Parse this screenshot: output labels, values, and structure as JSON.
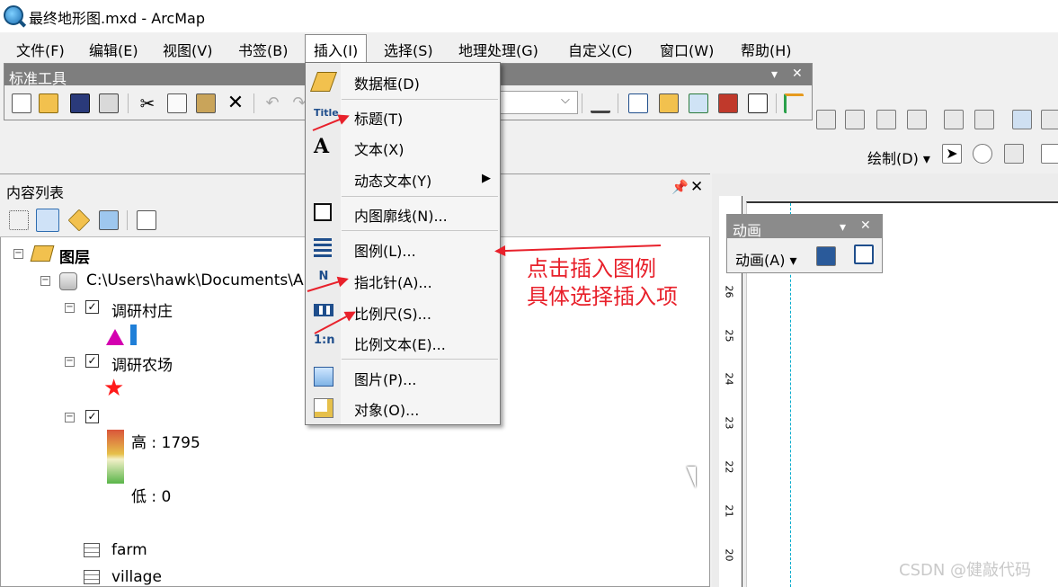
{
  "window": {
    "title": "最终地形图.mxd - ArcMap"
  },
  "menubar": {
    "items": [
      "文件(F)",
      "编辑(E)",
      "视图(V)",
      "书签(B)",
      "插入(I)",
      "选择(S)",
      "地理处理(G)",
      "自定义(C)",
      "窗口(W)",
      "帮助(H)"
    ],
    "active": "插入(I)"
  },
  "std_toolbar": {
    "title": "标准工具"
  },
  "right_toolbar": {
    "draw_label": "绘制(D)"
  },
  "toc": {
    "title": "内容列表",
    "root": "图层",
    "db_path": "C:\\Users\\hawk\\Documents\\A",
    "layers": [
      {
        "name": "调研村庄",
        "checked": true
      },
      {
        "name": "调研农场",
        "checked": true
      },
      {
        "name": "",
        "checked": true
      }
    ],
    "dem_high": "高 : 1795",
    "dem_low": "低 : 0",
    "tables": [
      "farm",
      "village"
    ]
  },
  "animation_toolbar": {
    "title": "动画",
    "menu": "动画(A)"
  },
  "ruler": {
    "labels": [
      "26",
      "25",
      "24",
      "23",
      "22",
      "21",
      "20"
    ]
  },
  "dropdown": {
    "items": [
      {
        "label": "数据框(D)",
        "icon": "data-frame-icon"
      },
      {
        "label": "标题(T)",
        "icon": "title-icon",
        "icon_text": "Title"
      },
      {
        "label": "文本(X)",
        "icon": "text-icon",
        "icon_text": "A"
      },
      {
        "label": "动态文本(Y)",
        "icon": "",
        "submenu": true
      },
      {
        "label": "内图廓线(N)...",
        "icon": "neatline-icon"
      },
      {
        "label": "图例(L)...",
        "icon": "legend-icon"
      },
      {
        "label": "指北针(A)...",
        "icon": "north-arrow-icon",
        "icon_text": "N"
      },
      {
        "label": "比例尺(S)...",
        "icon": "scale-bar-icon"
      },
      {
        "label": "比例文本(E)...",
        "icon": "scale-text-icon",
        "icon_text": "1:n"
      },
      {
        "label": "图片(P)...",
        "icon": "picture-icon"
      },
      {
        "label": "对象(O)...",
        "icon": "object-icon"
      }
    ]
  },
  "annotation": {
    "line1": "点击插入图例",
    "line2": "具体选择插入项"
  },
  "watermark": "CSDN @健敲代码",
  "colors": {
    "accent_red": "#e8212b",
    "toolbar_header": "#7e7e7e"
  }
}
